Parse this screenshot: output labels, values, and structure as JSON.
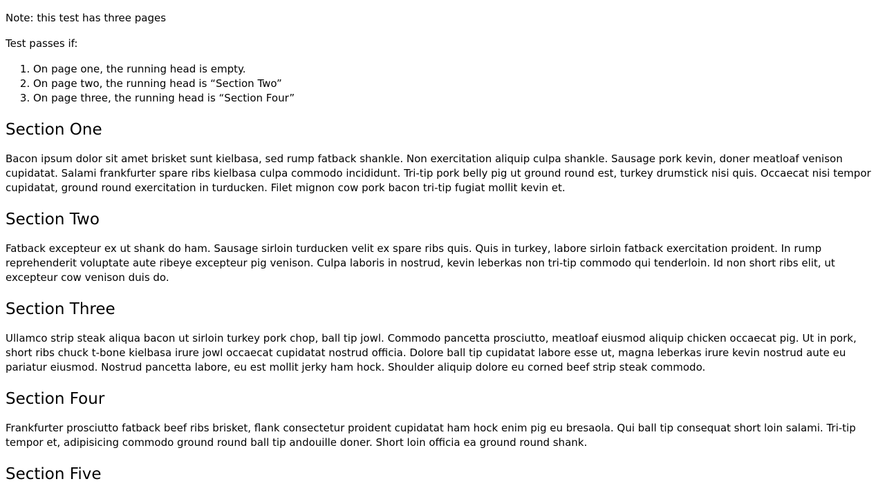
{
  "note": "Note: this test has three pages",
  "passes_intro": "Test passes if:",
  "criteria": [
    "On page one, the running head is empty.",
    "On page two, the running head is “Section Two”",
    "On page three, the running head is “Section Four”"
  ],
  "sections": [
    {
      "heading": "Section One",
      "body": "Bacon ipsum dolor sit amet brisket sunt kielbasa, sed rump fatback shankle. Non exercitation aliquip culpa shankle. Sausage pork kevin, doner meatloaf venison cupidatat. Salami frankfurter spare ribs kielbasa culpa commodo incididunt. Tri-tip pork belly pig ut ground round est, turkey drumstick nisi quis. Occaecat nisi tempor cupidatat, ground round exercitation in turducken. Filet mignon cow pork bacon tri-tip fugiat mollit kevin et."
    },
    {
      "heading": "Section Two",
      "body": "Fatback excepteur ex ut shank do ham. Sausage sirloin turducken velit ex spare ribs quis. Quis in turkey, labore sirloin fatback exercitation proident. In rump reprehenderit voluptate aute ribeye excepteur pig venison. Culpa laboris in nostrud, kevin leberkas non tri-tip commodo qui tenderloin. Id non short ribs elit, ut excepteur cow venison duis do."
    },
    {
      "heading": "Section Three",
      "body": "Ullamco strip steak aliqua bacon ut sirloin turkey pork chop, ball tip jowl. Commodo pancetta prosciutto, meatloaf eiusmod aliquip chicken occaecat pig. Ut in pork, short ribs chuck t-bone kielbasa irure jowl occaecat cupidatat nostrud officia. Dolore ball tip cupidatat labore esse ut, magna leberkas irure kevin nostrud aute eu pariatur eiusmod. Nostrud pancetta labore, eu est mollit jerky ham hock. Shoulder aliquip dolore eu corned beef strip steak commodo."
    },
    {
      "heading": "Section Four",
      "body": "Frankfurter prosciutto fatback beef ribs brisket, flank consectetur proident cupidatat ham hock enim pig eu bresaola. Qui ball tip consequat short loin salami. Tri-tip tempor et, adipisicing commodo ground round ball tip andouille doner. Short loin officia ea ground round shank."
    },
    {
      "heading": "Section Five",
      "body": ""
    }
  ]
}
